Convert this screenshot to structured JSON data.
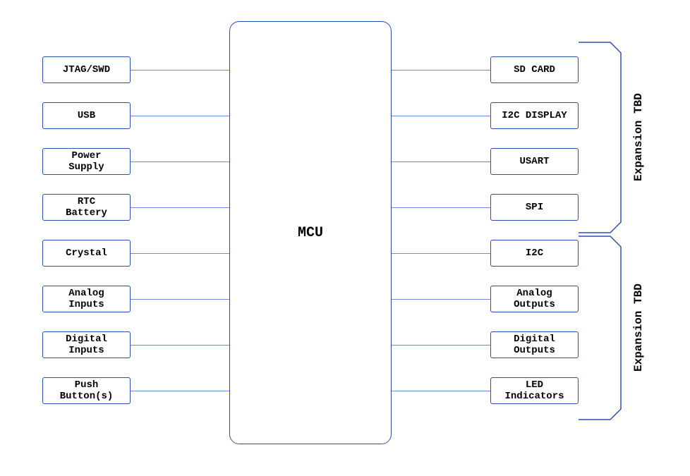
{
  "mcu": {
    "label": "MCU"
  },
  "left_blocks": [
    {
      "label": "JTAG/SWD"
    },
    {
      "label": "USB"
    },
    {
      "label": "Power\nSupply"
    },
    {
      "label": "RTC\nBattery"
    },
    {
      "label": "Crystal"
    },
    {
      "label": "Analog\nInputs"
    },
    {
      "label": "Digital\nInputs"
    },
    {
      "label": "Push\nButton(s)"
    }
  ],
  "right_blocks": [
    {
      "label": "SD CARD"
    },
    {
      "label": "I2C DISPLAY"
    },
    {
      "label": "USART"
    },
    {
      "label": "SPI"
    },
    {
      "label": "I2C"
    },
    {
      "label": "Analog\nOutputs"
    },
    {
      "label": "Digital\nOutputs"
    },
    {
      "label": "LED\nIndicators"
    }
  ],
  "expansion": {
    "top_label": "Expansion TBD",
    "bottom_label": "Expansion TBD"
  }
}
